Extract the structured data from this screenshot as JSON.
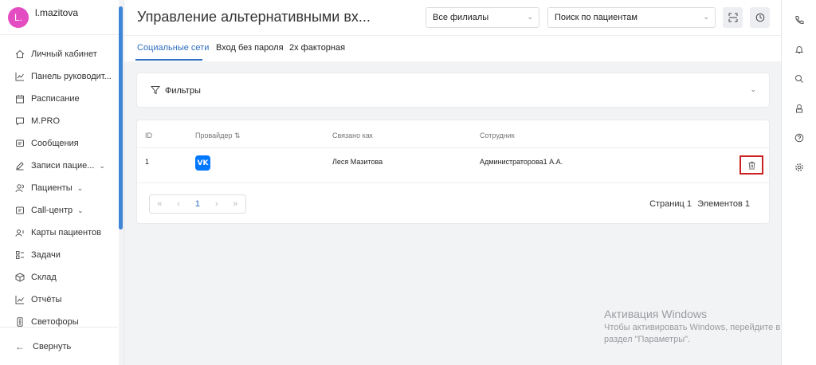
{
  "user": {
    "initial": "L.",
    "name": "l.mazitova",
    "avatar_color": "#e44cc2"
  },
  "sidebar": {
    "items": [
      {
        "label": "Личный кабинет",
        "icon": "home-icon"
      },
      {
        "label": "Панель руководит...",
        "icon": "chart-icon"
      },
      {
        "label": "Расписание",
        "icon": "calendar-icon"
      },
      {
        "label": "M.PRO",
        "icon": "chat-icon"
      },
      {
        "label": "Сообщения",
        "icon": "message-icon"
      },
      {
        "label": "Записи пацие...",
        "icon": "edit-icon",
        "expandable": true
      },
      {
        "label": "Пациенты",
        "icon": "users-icon",
        "expandable": true
      },
      {
        "label": "Call-центр",
        "icon": "headset-icon",
        "expandable": true
      },
      {
        "label": "Карты пациентов",
        "icon": "id-card-icon"
      },
      {
        "label": "Задачи",
        "icon": "tasks-icon"
      },
      {
        "label": "Склад",
        "icon": "box-icon"
      },
      {
        "label": "Отчёты",
        "icon": "report-icon"
      },
      {
        "label": "Светофоры",
        "icon": "traffic-light-icon"
      }
    ],
    "collapse_label": "Свернуть"
  },
  "header": {
    "title": "Управление альтернативными вх...",
    "branch_select": "Все филиалы",
    "patient_search": "Поиск по пациентам"
  },
  "tabs": [
    {
      "label": "Социальные сети",
      "active": true
    },
    {
      "label": "Вход без пароля",
      "active": false
    },
    {
      "label": "2х факторная",
      "active": false
    }
  ],
  "filters": {
    "label": "Фильтры"
  },
  "table": {
    "columns": [
      "ID",
      "Провайдер",
      "Связано как",
      "Сотрудник"
    ],
    "sort_indicator": "⇅",
    "rows": [
      {
        "id": "1",
        "provider": "VK",
        "linked_as": "Леся Мазитова",
        "employee": "Администраторова1 А.А."
      }
    ],
    "pagination": {
      "current_page": "1",
      "pages_label": "Страниц 1",
      "elements_label": "Элементов 1"
    }
  },
  "watermark": {
    "title": "Активация Windows",
    "line1": "Чтобы активировать Windows, перейдите в",
    "line2": "раздел \"Параметры\"."
  },
  "colors": {
    "accent": "#2d6fbf",
    "vk_blue": "#0077ff",
    "delete_highlight": "#cc2222",
    "scroll_thumb": "#3f86d6"
  }
}
